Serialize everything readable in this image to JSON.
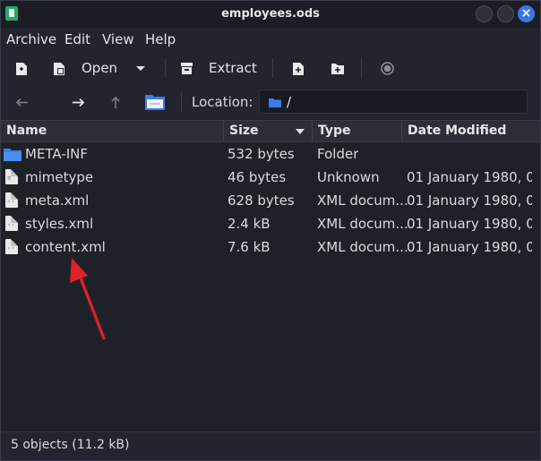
{
  "window": {
    "title": "employees.ods",
    "close_glyph": "×"
  },
  "menubar": {
    "items": [
      {
        "label": "Archive"
      },
      {
        "label": "Edit"
      },
      {
        "label": "View"
      },
      {
        "label": "Help"
      }
    ]
  },
  "toolbar": {
    "open_label": "Open",
    "extract_label": "Extract",
    "icons": [
      "new-archive-icon",
      "open-archive-icon",
      "dropdown-arrow-icon",
      "extract-icon",
      "add-file-icon",
      "add-folder-icon",
      "stop-icon"
    ]
  },
  "locationbar": {
    "label": "Location:",
    "path": "/",
    "icons": [
      "back-arrow-icon",
      "forward-arrow-icon",
      "up-arrow-icon",
      "home-folder-icon",
      "folder-icon"
    ]
  },
  "table": {
    "columns": [
      "Name",
      "Size",
      "Type",
      "Date Modified"
    ],
    "rows": [
      {
        "name": "META-INF",
        "size": "532 bytes",
        "type": "Folder",
        "date": "",
        "icon": "folder-icon"
      },
      {
        "name": "mimetype",
        "size": "46 bytes",
        "type": "Unknown",
        "date": "01 January 1980, 0...",
        "icon": "text-file-icon"
      },
      {
        "name": "meta.xml",
        "size": "628 bytes",
        "type": "XML docum...",
        "date": "01 January 1980, 0...",
        "icon": "xml-file-icon"
      },
      {
        "name": "styles.xml",
        "size": "2.4 kB",
        "type": "XML docum...",
        "date": "01 January 1980, 0...",
        "icon": "xml-file-icon"
      },
      {
        "name": "content.xml",
        "size": "7.6 kB",
        "type": "XML docum...",
        "date": "01 January 1980, 0...",
        "icon": "xml-file-icon"
      }
    ]
  },
  "statusbar": {
    "text": "5 objects (11.2 kB)"
  },
  "colors": {
    "accent": "#3877e6",
    "folder": "#3a7ee8",
    "annotation_arrow": "#e0202a"
  }
}
